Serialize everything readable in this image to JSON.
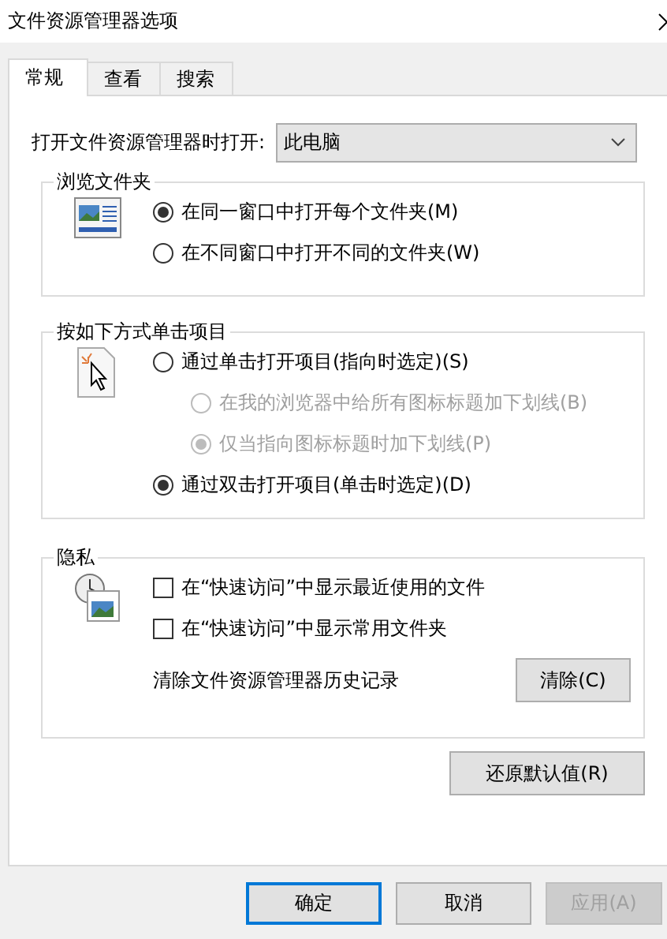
{
  "window": {
    "title": "文件资源管理器选项"
  },
  "tabs": [
    {
      "label": "常规",
      "selected": true
    },
    {
      "label": "查看",
      "selected": false
    },
    {
      "label": "搜索",
      "selected": false
    }
  ],
  "startup": {
    "label": "打开文件资源管理器时打开:",
    "value": "此电脑"
  },
  "browse_folders": {
    "title": "浏览文件夹",
    "options": [
      {
        "label": "在同一窗口中打开每个文件夹(M)",
        "selected": true
      },
      {
        "label": "在不同窗口中打开不同的文件夹(W)",
        "selected": false
      }
    ]
  },
  "click_items": {
    "title": "按如下方式单击项目",
    "options": [
      {
        "label": "通过单击打开项目(指向时选定)(S)",
        "selected": false,
        "children": [
          {
            "label": "在我的浏览器中给所有图标标题加下划线(B)",
            "selected": false,
            "disabled": true
          },
          {
            "label": "仅当指向图标标题时加下划线(P)",
            "selected": true,
            "disabled": true
          }
        ]
      },
      {
        "label": "通过双击打开项目(单击时选定)(D)",
        "selected": true
      }
    ]
  },
  "privacy": {
    "title": "隐私",
    "checkboxes": [
      {
        "label": "在“快速访问”中显示最近使用的文件",
        "checked": false
      },
      {
        "label": "在“快速访问”中显示常用文件夹",
        "checked": false
      }
    ],
    "clear_label": "清除文件资源管理器历史记录",
    "clear_button": "清除(C)"
  },
  "restore_button": "还原默认值(R)",
  "buttons": [
    {
      "label": "确定",
      "kind": "default",
      "disabled": false
    },
    {
      "label": "取消",
      "kind": "normal",
      "disabled": false
    },
    {
      "label": "应用(A)",
      "kind": "normal",
      "disabled": true
    }
  ]
}
